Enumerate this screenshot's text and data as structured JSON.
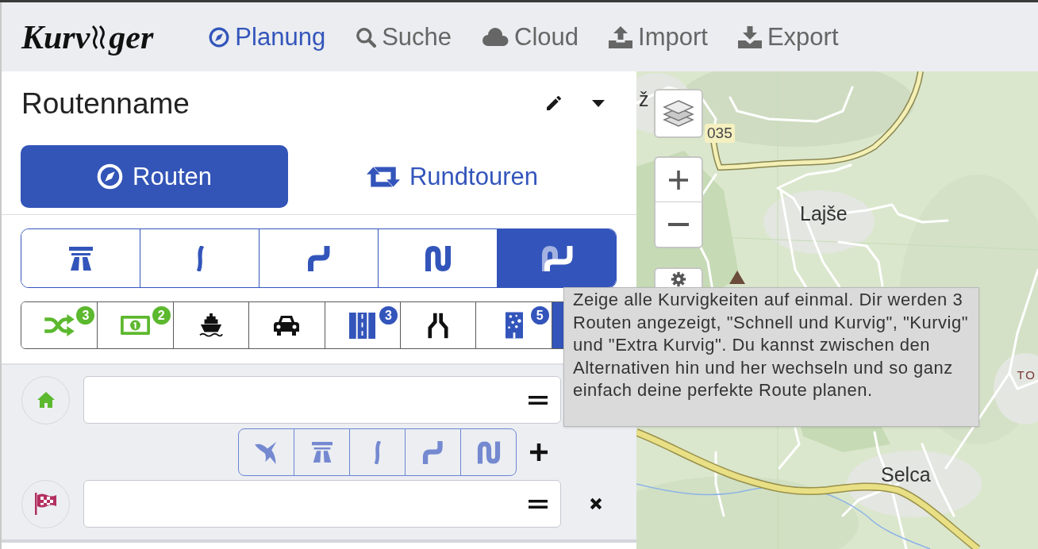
{
  "header": {
    "logo": {
      "before": "Kurv",
      "after": "ger"
    },
    "nav": [
      {
        "label": "Planung",
        "selected": true
      },
      {
        "label": "Suche",
        "selected": false
      },
      {
        "label": "Cloud",
        "selected": false
      },
      {
        "label": "Import",
        "selected": false
      },
      {
        "label": "Export",
        "selected": false
      }
    ]
  },
  "route": {
    "name": "Routenname"
  },
  "modes": [
    {
      "label": "Routen",
      "selected": true
    },
    {
      "label": "Rundtouren",
      "selected": false
    }
  ],
  "curviness": [
    {
      "selected": false
    },
    {
      "selected": false
    },
    {
      "selected": false
    },
    {
      "selected": false
    },
    {
      "selected": true
    }
  ],
  "options": [
    {
      "color": "#5cb82e",
      "badge": "3",
      "selected": false
    },
    {
      "color": "#5cb82e",
      "badge": "2",
      "selected": false
    },
    {
      "color": "#111111",
      "selected": false
    },
    {
      "color": "#111111",
      "selected": false
    },
    {
      "color": "#3355bb",
      "badge": "3",
      "selected": false
    },
    {
      "color": "#111111",
      "selected": false
    },
    {
      "color": "#3355bb",
      "badge": "5",
      "selected": false
    },
    {
      "selected": true
    }
  ],
  "waypoints": [
    {
      "kind": "start"
    },
    {
      "kind": "destination"
    }
  ],
  "tooltip": {
    "text": "Zeige alle Kurvigkeiten auf einmal. Dir werden 3 Routen angezeigt, \"Schnell und Kurvig\", \"Kurvig\" und \"Extra Kurvig\". Du kannst zwischen den Alternativen hin und her wechseln und so ganz einfach deine perfekte Route planen."
  },
  "map": {
    "labels": [
      {
        "text": "ž",
        "kind": "place"
      },
      {
        "text": "035",
        "kind": "road_ref"
      },
      {
        "text": "Lajše",
        "kind": "place"
      },
      {
        "text": "Selca",
        "kind": "place"
      },
      {
        "text": "TO",
        "kind": "region"
      }
    ]
  }
}
